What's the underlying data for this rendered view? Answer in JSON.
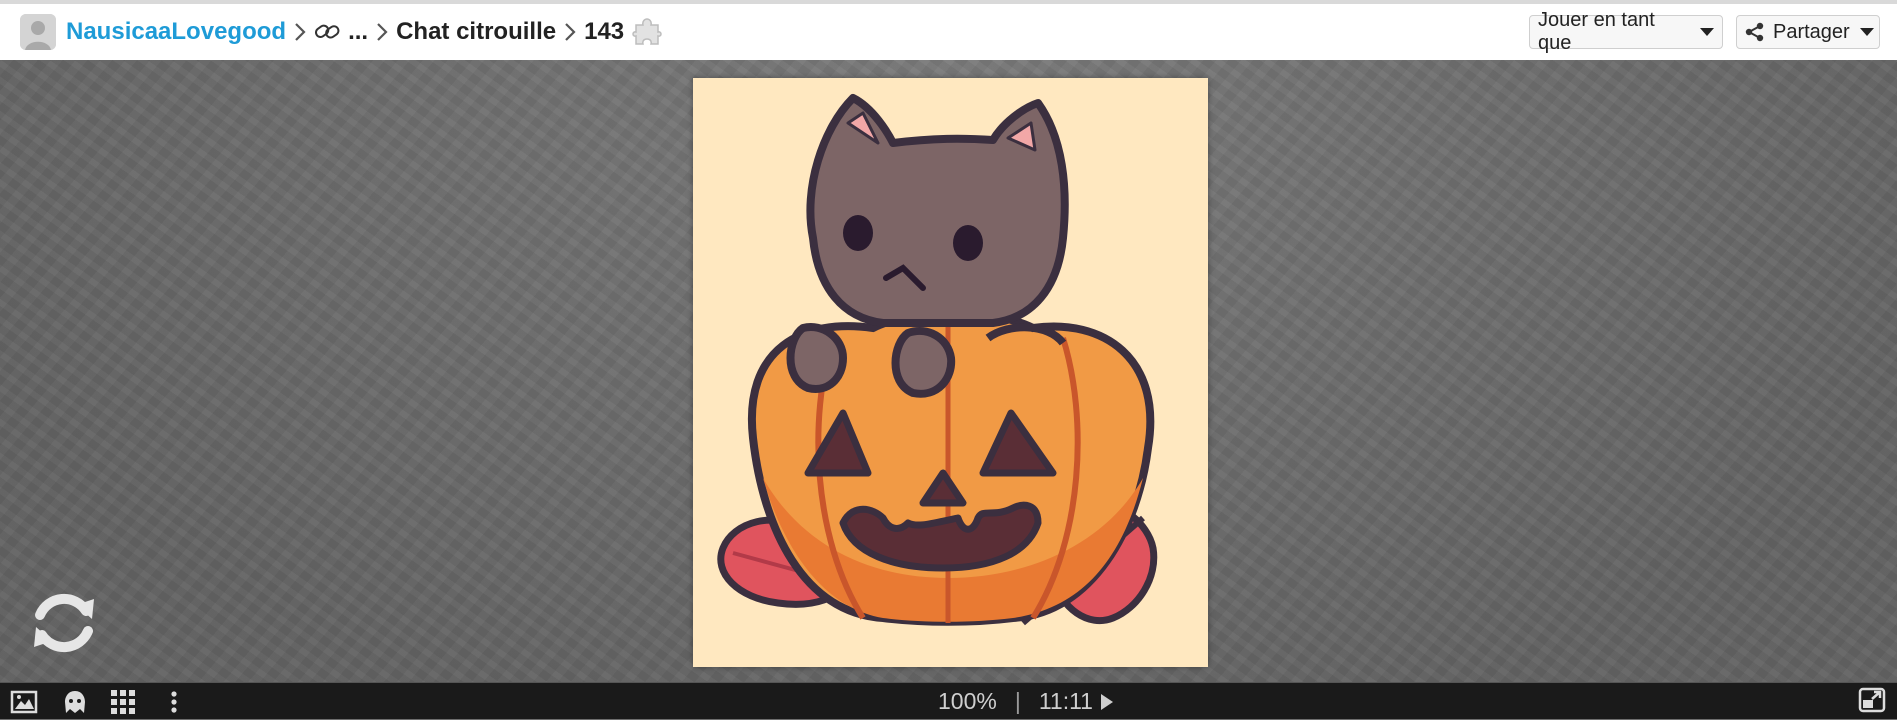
{
  "header": {
    "user_name": "NausicaaLovegood",
    "ellipsis": "...",
    "collection": "Chat citrouille",
    "piece_count": "143",
    "play_as_label": "Jouer en tant que",
    "share_label": "Partager"
  },
  "status": {
    "zoom": "100%",
    "separator": "|",
    "timer": "11:11"
  },
  "colors": {
    "accent": "#1e9bd7",
    "image_background": "#ffe8c0",
    "cat": "#7d6566",
    "pumpkin": "#f19a45",
    "leaf": "#e0545e",
    "outline": "#3b2f3f"
  },
  "icons": [
    "user-avatar",
    "link-icon",
    "puzzle-piece-icon",
    "share-icon",
    "refresh-icon",
    "image-icon",
    "ghost-icon",
    "grid-icon",
    "more-vertical-icon",
    "fullscreen-icon"
  ]
}
